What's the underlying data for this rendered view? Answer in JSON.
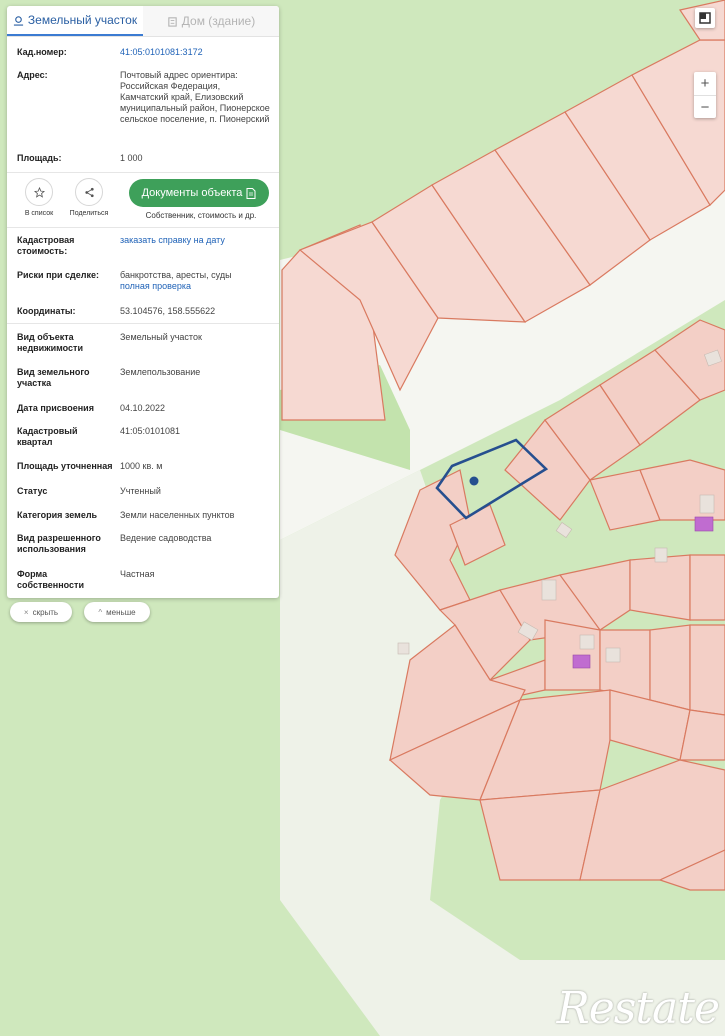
{
  "tabs": {
    "land": "Земельный участок",
    "house": "Дом (здание)"
  },
  "info": {
    "cad_number": {
      "label": "Кад.номер:",
      "value": "41:05:0101081:3172"
    },
    "address": {
      "label": "Адрес:",
      "value": "Почтовый адрес ориентира: Российская Федерация, Камчатский край, Елизовский муниципальный район, Пионерское сельское поселение, п. Пионерский"
    },
    "area": {
      "label": "Площадь:",
      "value": "1 000"
    }
  },
  "actions": {
    "list": "В список",
    "share": "Поделиться",
    "documents": "Документы объекта",
    "documents_sub": "Собственник, стоимость и др."
  },
  "details": {
    "cad_cost": {
      "label": "Кадастровая стоимость:",
      "value": "заказать справку на дату"
    },
    "risks": {
      "label": "Риски при сделке:",
      "value": "банкротства, аресты, суды",
      "link": "полная проверка"
    },
    "coords": {
      "label": "Координаты:",
      "value": "53.104576, 158.555622"
    }
  },
  "attributes": [
    {
      "label": "Вид объекта недвижимости",
      "value": "Земельный участок"
    },
    {
      "label": "Вид земельного участка",
      "value": "Землепользование"
    },
    {
      "label": "Дата присвоения",
      "value": "04.10.2022"
    },
    {
      "label": "Кадастровый квартал",
      "value": "41:05:0101081"
    },
    {
      "label": "Площадь уточненная",
      "value": "1000 кв. м"
    },
    {
      "label": "Статус",
      "value": "Учтенный"
    },
    {
      "label": "Категория земель",
      "value": "Земли населенных пунктов"
    },
    {
      "label": "Вид разрешенного использования",
      "value": "Ведение садоводства"
    },
    {
      "label": "Форма собственности",
      "value": "Частная"
    }
  ],
  "buttons": {
    "hide": "скрыть",
    "less": "меньше"
  },
  "zoom": {
    "in": "+",
    "out": "−"
  },
  "logo": "Restate",
  "colors": {
    "forest": "#cfe8bd",
    "parcel_fill": "#f6d9d2",
    "parcel_stroke": "#d97a60",
    "selected_stroke": "#264f8f",
    "button_green": "#3ea05a"
  }
}
